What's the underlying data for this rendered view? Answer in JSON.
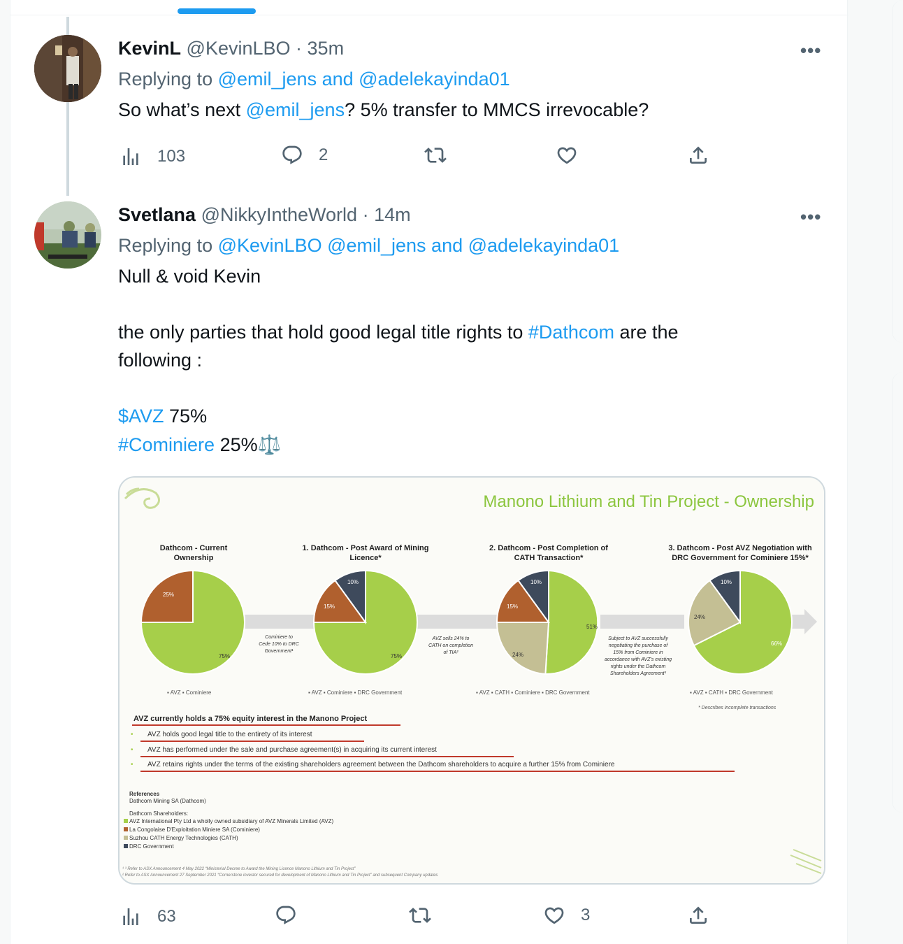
{
  "tweets": [
    {
      "name": "KevinL",
      "handle": "@KevinLBO",
      "time": "· 35m",
      "reply_prefix": "Replying to",
      "reply_mentions": "@emil_jens and @adelekayinda01",
      "text_parts": [
        "So what’s next ",
        "@emil_jens",
        "? 5% transfer to MMCS irrevocable?"
      ],
      "stats": {
        "views": "103",
        "replies": "2",
        "retweets": "",
        "likes": ""
      },
      "more_label": "•••"
    },
    {
      "name": "Svetlana",
      "handle": "@NikkyIntheWorld",
      "time": "· 14m",
      "reply_prefix": "Replying to",
      "reply_mentions": "@KevinLBO @emil_jens and @adelekayinda01",
      "text_lines": {
        "l1": "Null & void Kevin",
        "l2a": "the only parties that hold good legal title rights to ",
        "l2tag": "#Dathcom",
        "l2b": " are the",
        "l3": "following :",
        "l4tag": "$AVZ",
        "l4b": " 75%",
        "l5tag": "#Cominiere",
        "l5b": " 25%⚖️"
      },
      "stats": {
        "views": "63",
        "replies": "",
        "retweets": "",
        "likes": "3"
      },
      "more_label": "•••"
    }
  ],
  "slide": {
    "title": "Manono Lithium and Tin Project - Ownership",
    "pies": [
      {
        "title1": "Dathcom - Current",
        "title2": "Ownership",
        "legend": "▪ AVZ   ▪ Cominiere"
      },
      {
        "title1": "1. Dathcom - Post Award of Mining",
        "title2": "Licence*",
        "legend": "▪ AVZ   ▪ Cominiere   ▪ DRC Government"
      },
      {
        "title1": "2. Dathcom - Post Completion of",
        "title2": "CATH Transaction*",
        "legend": "▪ AVZ   ▪ CATH   ▪ Cominiere   ▪ DRC Government"
      },
      {
        "title1": "3. Dathcom - Post AVZ Negotiation with",
        "title2": "DRC Government for Cominiere 15%*",
        "legend": "▪ AVZ   ▪ CATH   ▪ DRC Government"
      }
    ],
    "pie_labels": {
      "p1": [
        "25%",
        "75%"
      ],
      "p2": [
        "10%",
        "15%",
        "75%"
      ],
      "p3": [
        "10%",
        "15%",
        "51%",
        "24%"
      ],
      "p4": [
        "10%",
        "24%",
        "66%"
      ]
    },
    "arrows": {
      "a1": [
        "Cominiere to",
        "Cede 10% to DRC",
        "Government¹"
      ],
      "a2": [
        "AVZ sells 24% to",
        "CATH on completion",
        "of TIA²"
      ],
      "a3": [
        "Subject to AVZ successfully",
        "negotiating the purchase of",
        "15% from Cominiere in",
        "accordance with AVZ's existing",
        "rights under the Dathcom",
        "Shareholders Agreement³"
      ]
    },
    "footnote_star": "* Describes incomplete transactions",
    "headline": "AVZ currently holds a 75% equity interest in the Manono Project",
    "bullets": [
      "AVZ holds good legal title to the entirety of its interest",
      "AVZ has performed under the sale and purchase agreement(s) in acquiring its current interest",
      "AVZ retains rights under the terms of the existing shareholders agreement between the Dathcom shareholders to acquire a further 15% from Cominiere"
    ],
    "references": {
      "heading": "References",
      "dathcom": "Dathcom Mining SA (Dathcom)",
      "shareholders": "Dathcom Shareholders:",
      "items": [
        "AVZ International Pty Ltd a wholly owned subsidiary of AVZ Minerals Limited (AVZ)",
        "La Congolaise D'Exploitation Miniere SA (Cominiere)",
        "Suzhou CATH Energy Technologies (CATH)",
        "DRC Government"
      ],
      "notes": [
        "¹ ³ Refer to ASX Announcement 4 May 2022 “Ministerial Decree to Award the Mining Licence Manono Lithium and Tin Project”",
        "² Refer to ASX Announcement 27 September 2021 “Cornerstone investor secured for development of Manono Lithium and Tin Project” and subsequent Company updates"
      ]
    },
    "colors": {
      "avz": "#a6cf4a",
      "cominiere": "#b0602e",
      "drc": "#3e4a5c",
      "cath": "#c4bf94",
      "title": "#8cc63f",
      "underline": "#c0392b"
    }
  }
}
